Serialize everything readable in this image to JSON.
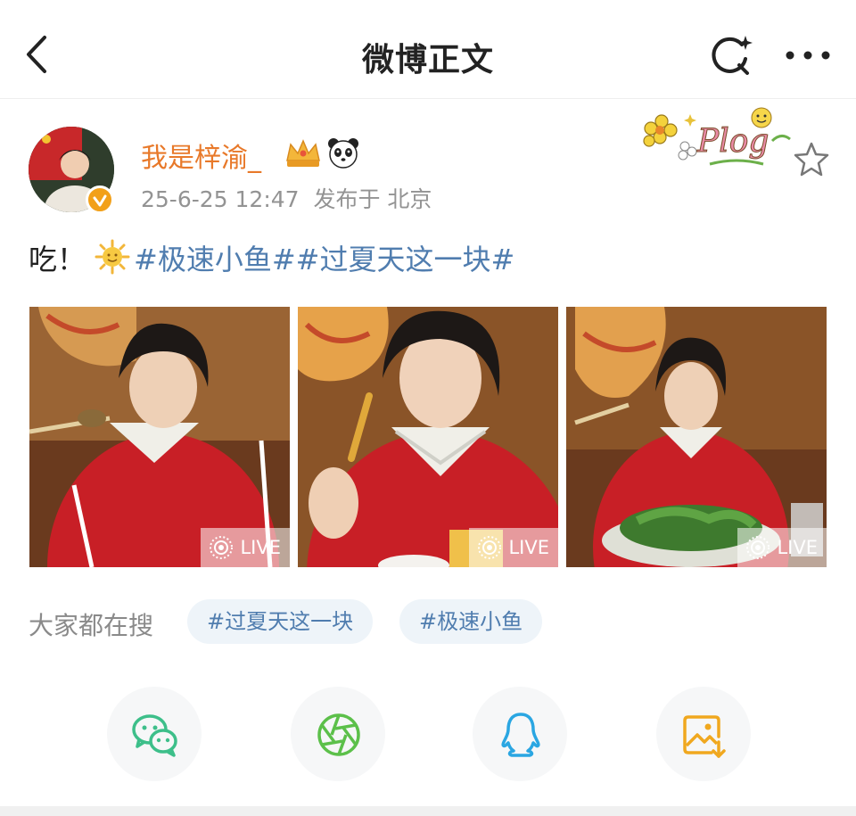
{
  "nav": {
    "title": "微博正文",
    "back_icon": "back-arrow-icon",
    "search_icon": "search-icon",
    "more_icon": "more-dots-icon"
  },
  "post": {
    "username": "我是梓渝_",
    "username_color": "#e8792a",
    "meta": "25-6-25 12:47  发布于 北京",
    "sticker_text": "Plog",
    "text_prefix": "吃！",
    "topics": [
      "#极速小鱼#",
      "#过夏天这一块#"
    ],
    "photos": [
      {
        "live_label": "LIVE"
      },
      {
        "live_label": "LIVE"
      },
      {
        "live_label": "LIVE"
      }
    ]
  },
  "hot_search": {
    "label": "大家都在搜",
    "chips": [
      "#过夏天这一块",
      "#极速小鱼"
    ]
  },
  "share": [
    {
      "name": "wechat",
      "icon": "wechat-icon",
      "color": "#3dbf8a"
    },
    {
      "name": "moments",
      "icon": "moments-icon",
      "color": "#5cc04a"
    },
    {
      "name": "qq",
      "icon": "qq-icon",
      "color": "#2aa6e2"
    },
    {
      "name": "save-image",
      "icon": "save-image-icon",
      "color": "#f0a81f"
    }
  ],
  "colors": {
    "topic": "#507daf",
    "meta": "#939393",
    "chip_bg": "#eef4f9"
  }
}
